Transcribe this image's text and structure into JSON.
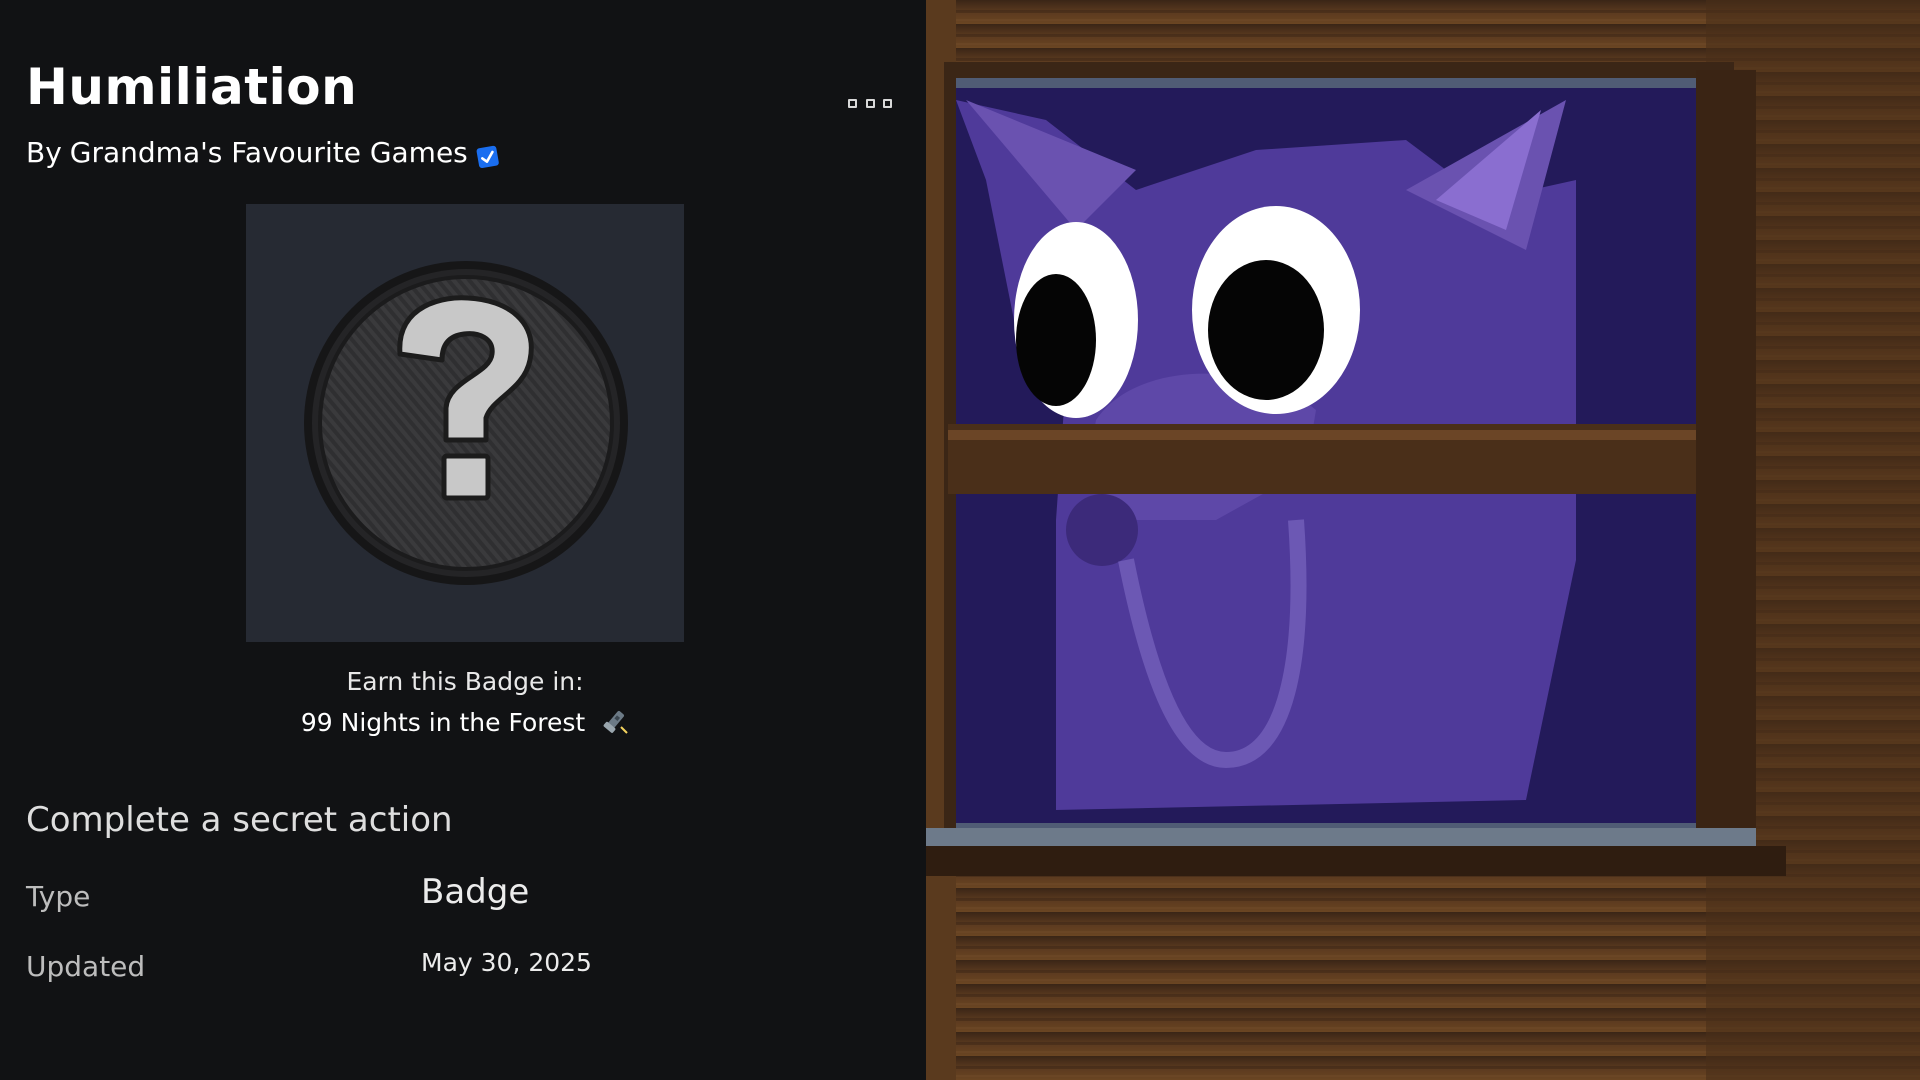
{
  "badge": {
    "title": "Humiliation",
    "by_prefix": "By",
    "creator": "Grandma's Favourite Games",
    "earn_label": "Earn this Badge in:",
    "game_name": "99 Nights in the Forest",
    "description": "Complete a secret action",
    "details": {
      "type_label": "Type",
      "type_value": "Badge",
      "updated_label": "Updated",
      "updated_value": "May 30, 2025"
    }
  },
  "icons": {
    "more": "more-options-icon",
    "verified": "verified-check-icon",
    "flashlight": "flashlight-emoji",
    "placeholder": "question-mark-badge-icon"
  },
  "colors": {
    "background": "#111214",
    "badge_frame": "#262a33",
    "verified_blue": "#1a6ef0",
    "scene_wood": "#5a3a1e",
    "creature_purple": "#4f3a9a"
  }
}
